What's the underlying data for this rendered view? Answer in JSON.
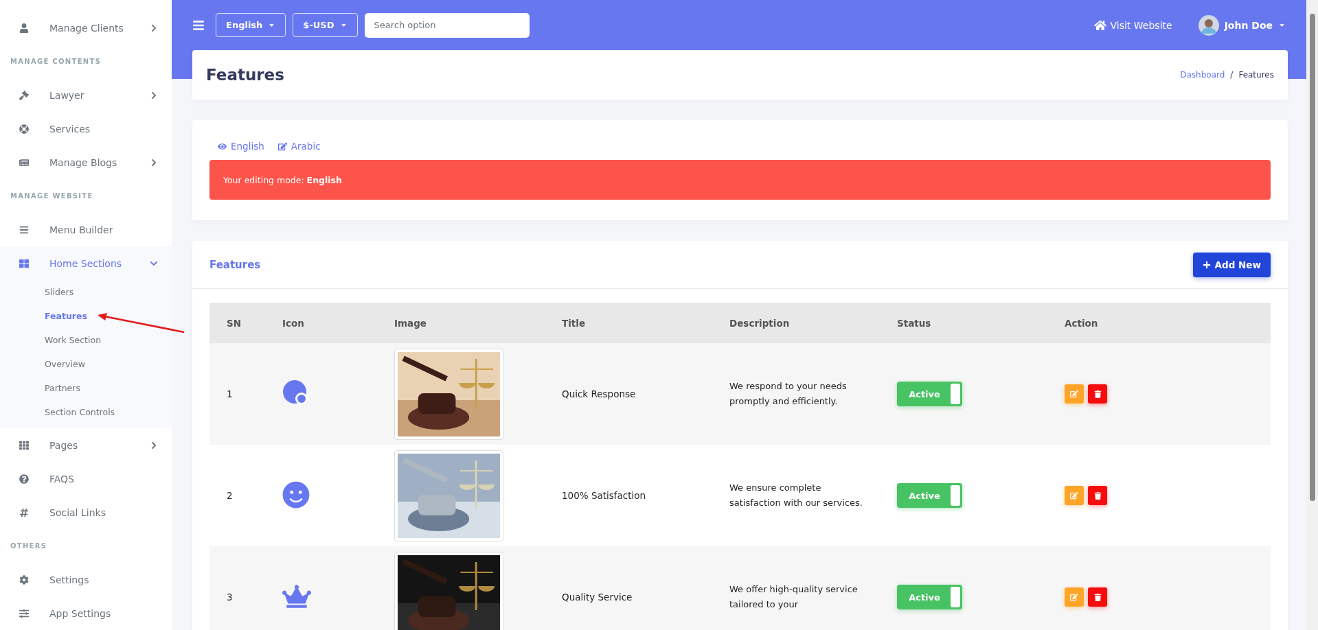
{
  "sidebar": {
    "items": [
      {
        "kind": "link",
        "label": "Manage Clients",
        "selected": false,
        "expanded": false
      },
      {
        "kind": "heading",
        "label": "MANAGE CONTENTS"
      },
      {
        "kind": "link",
        "label": "Lawyer",
        "selected": false,
        "expanded": false
      },
      {
        "kind": "link",
        "label": "Services",
        "selected": false
      },
      {
        "kind": "link",
        "label": "Manage Blogs",
        "selected": false,
        "expanded": false
      },
      {
        "kind": "heading",
        "label": "MANAGE WEBSITE"
      },
      {
        "kind": "link",
        "label": "Menu Builder",
        "selected": false
      },
      {
        "kind": "link",
        "label": "Home Sections",
        "selected": true,
        "expanded": true,
        "children": [
          {
            "label": "Sliders",
            "selected": false
          },
          {
            "label": "Features",
            "selected": true
          },
          {
            "label": "Work Section",
            "selected": false
          },
          {
            "label": "Overview",
            "selected": false
          },
          {
            "label": "Partners",
            "selected": false
          },
          {
            "label": "Section Controls",
            "selected": false
          }
        ]
      },
      {
        "kind": "link",
        "label": "Pages",
        "selected": false,
        "expanded": false
      },
      {
        "kind": "link",
        "label": "FAQS",
        "selected": false
      },
      {
        "kind": "link",
        "label": "Social Links",
        "selected": false
      },
      {
        "kind": "heading",
        "label": "OTHERS"
      },
      {
        "kind": "link",
        "label": "Settings",
        "selected": false
      },
      {
        "kind": "link",
        "label": "App Settings",
        "selected": false
      }
    ]
  },
  "topbar": {
    "language": "English",
    "currency": "$-USD",
    "search": {
      "placeholder": "Search option"
    },
    "visit_link": "Visit Website",
    "user": "John Doe"
  },
  "page_header": {
    "title": "Features",
    "breadcrumb": [
      {
        "label": "Dashboard",
        "link": true
      },
      {
        "label": "Features",
        "link": false
      }
    ],
    "breadcrumb_separator": "/"
  },
  "language_tabs": [
    {
      "label": "English",
      "kind": "view"
    },
    {
      "label": "Arabic",
      "kind": "edit"
    }
  ],
  "alert": {
    "text": "Your editing mode: **English**"
  },
  "features_card": {
    "title": "Features",
    "add_button": "Add New",
    "table": {
      "columns": [
        "SN",
        "Icon",
        "Image",
        "Title",
        "Description",
        "Status",
        "Action"
      ],
      "rows": [
        {
          "sn": "1",
          "title": "Quick Response",
          "description": "We respond to your needs promptly and efficiently.",
          "status": {
            "label": "Active",
            "on": true
          }
        },
        {
          "sn": "2",
          "title": "100% Satisfaction",
          "description": "We ensure complete satisfaction with our services.",
          "status": {
            "label": "Active",
            "on": true
          }
        },
        {
          "sn": "3",
          "title": "Quality Service",
          "description": "We offer high-quality service tailored to your",
          "status": {
            "label": "Active",
            "on": true
          }
        }
      ]
    }
  }
}
